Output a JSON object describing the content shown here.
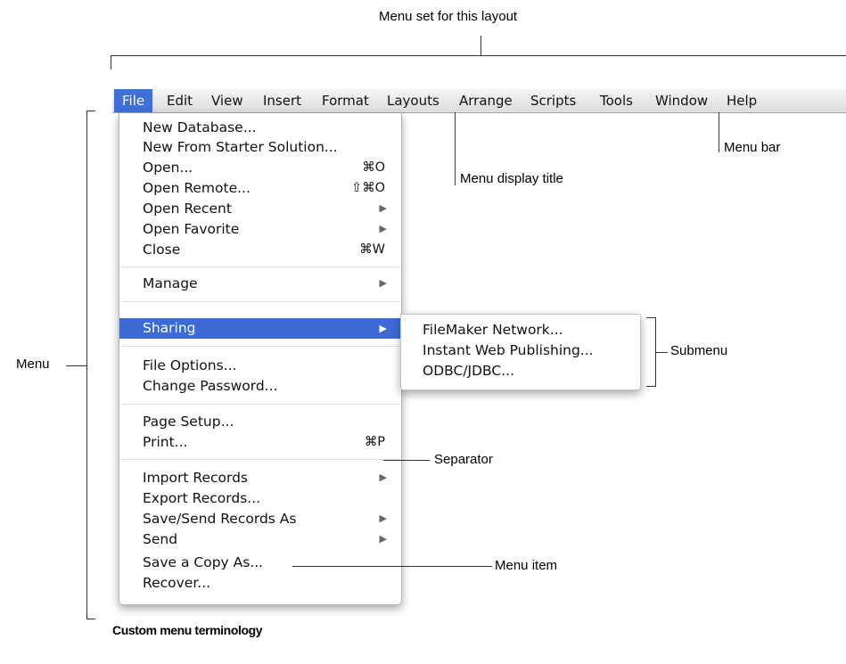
{
  "annotations": {
    "menu_set": "Menu set for this layout",
    "menu_bar": "Menu bar",
    "menu_display_title": "Menu display title",
    "submenu": "Submenu",
    "menu": "Menu",
    "separator": "Separator",
    "menu_item": "Menu item"
  },
  "caption": "Custom menu terminology",
  "menubar": [
    "File",
    "Edit",
    "View",
    "Insert",
    "Format",
    "Layouts",
    "Arrange",
    "Scripts",
    "Tools",
    "Window",
    "Help"
  ],
  "file_menu": {
    "new_database": "New Database...",
    "new_from_starter": "New From Starter Solution...",
    "open": "Open...",
    "open_sc": "⌘O",
    "open_remote": "Open Remote...",
    "open_remote_sc": "⇧⌘O",
    "open_recent": "Open Recent",
    "open_favorite": "Open Favorite",
    "close": "Close",
    "close_sc": "⌘W",
    "manage": "Manage",
    "sharing": "Sharing",
    "file_options": "File Options...",
    "change_password": "Change Password...",
    "page_setup": "Page Setup...",
    "print": "Print...",
    "print_sc": "⌘P",
    "import_records": "Import Records",
    "export_records": "Export Records...",
    "save_send": "Save/Send Records As",
    "send": "Send",
    "save_copy": "Save a Copy As...",
    "recover": "Recover...",
    "arrow": "▶"
  },
  "submenu": [
    "FileMaker Network...",
    "Instant Web Publishing...",
    "ODBC/JDBC..."
  ]
}
